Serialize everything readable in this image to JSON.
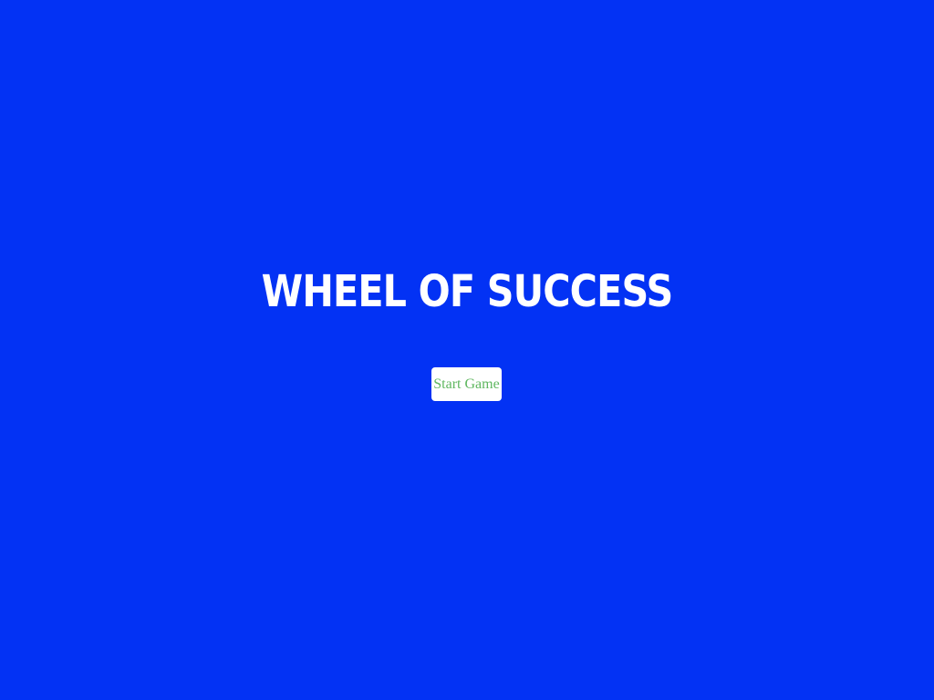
{
  "overlay": {
    "title": "WHEEL OF SUCCESS",
    "start_button_label": "Start Game"
  },
  "colors": {
    "background": "#0332f4",
    "title_text": "#ffffff",
    "button_background": "#ffffff",
    "button_text": "#5fb760"
  }
}
